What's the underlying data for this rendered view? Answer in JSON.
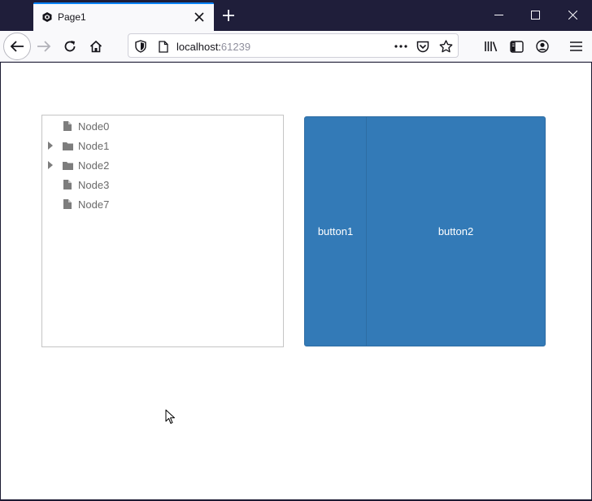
{
  "browser": {
    "tab_title": "Page1",
    "url_host": "localhost:",
    "url_port": "61239",
    "accent_color": "#0a84ff"
  },
  "tree": {
    "nodes": [
      {
        "label": "Node0",
        "type": "file",
        "expandable": false
      },
      {
        "label": "Node1",
        "type": "folder",
        "expandable": true
      },
      {
        "label": "Node2",
        "type": "folder",
        "expandable": true
      },
      {
        "label": "Node3",
        "type": "file",
        "expandable": false
      },
      {
        "label": "Node7",
        "type": "file",
        "expandable": false
      }
    ]
  },
  "buttons": {
    "button1_label": "button1",
    "button2_label": "button2",
    "color": "#337ab7"
  }
}
